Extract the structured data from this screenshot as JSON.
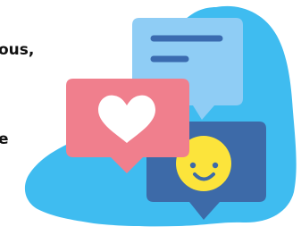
{
  "text": {
    "fragment_1": "ous,",
    "fragment_2": "e"
  },
  "colors": {
    "blob": "#3fbcf0",
    "top_bubble": "#8fcdf5",
    "top_bubble_lines": "#3a6bb0",
    "left_bubble": "#f07f8d",
    "heart": "#ffffff",
    "right_bubble": "#3d6aa8",
    "smiley": "#fce43b",
    "smiley_features": "#3d6aa8"
  },
  "icons": [
    "comment-lines-icon",
    "heart-icon",
    "smiley-icon"
  ]
}
